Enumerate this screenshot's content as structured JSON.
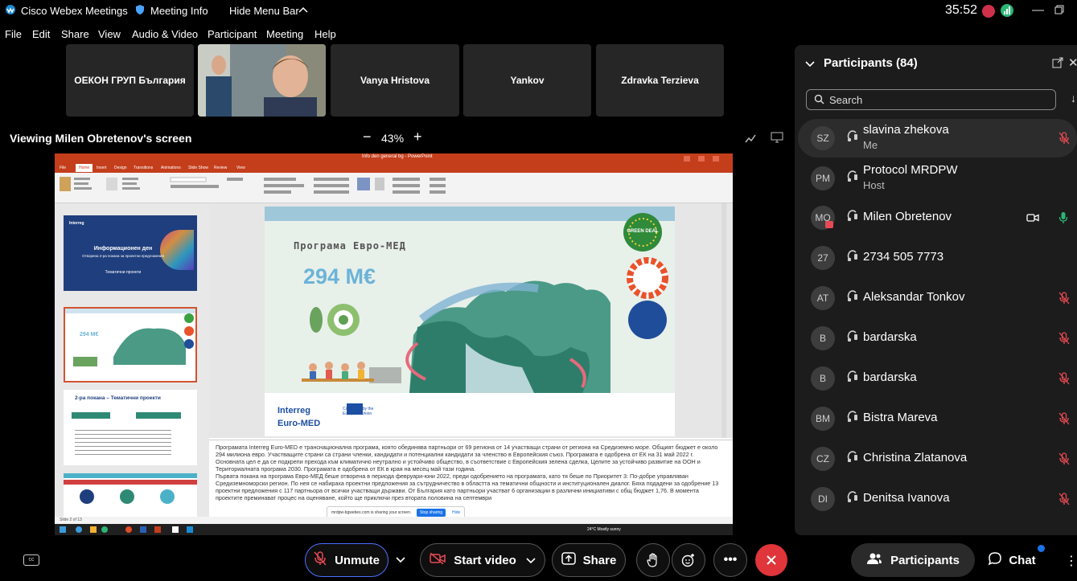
{
  "window": {
    "app_title": "Cisco Webex Meetings",
    "meeting_info": "Meeting Info",
    "hide_menu": "Hide Menu Bar",
    "timer": "35:52"
  },
  "menu": [
    "File",
    "Edit",
    "Share",
    "View",
    "Audio & Video",
    "Participant",
    "Meeting",
    "Help"
  ],
  "tiles": [
    "ОЕКОН ГРУП България",
    "",
    "Vanya Hristova",
    "Yankov",
    "Zdravka Terzieva"
  ],
  "viewing": {
    "label": "Viewing Milen Obretenov's screen",
    "zoom": "43%"
  },
  "slide": {
    "program_title": "Програма Евро-МЕД",
    "amount": "294 M€",
    "interreg": "Interreg",
    "euro_med": "Euro-MED",
    "cofunded": "Co-funded by the European Union",
    "notes_1": "Програмата Interreg Euro-MED е транснационална програма, която обединява партньори от 69 региона от 14 участващи страни от региона на Средиземно море. Общият бюджет е около 294 милиона евро. Участващите страни са страни членки, кандидати и потенциални кандидати за членство в Европейския съюз. Програмата е одобрена от ЕК на 31 май 2022 г. Основната цел е да се подкрепи прехода към климатично неутрално и устойчиво общество, в съответствие с Европейския зелена сделка, Целите за устойчиво развитие на ООН и Териториалната програма 2030. Програмата е одобрена от ЕК в края на месец май тази година.",
    "notes_2": "Първата покана на програма Евро-МЕД беше отворена в периода февруари-юни 2022, преди одобрението на програмата, като тя беше по Приоритет 3: По-добре управляван Средиземноморски регион. По нея се набираха проектни предложения за сътрудничество в областта на тематични общности и институционален диалог. Бяха подадени за одобрение 13 проектни предложения с 117 партньора от всички участващи държави. От България като партньори участват 6 организации в различни инициативи с общ бюджет 1,76. В момента проектите преминават процес на оценяване, който ще приключи през втората половина на септември",
    "sharing_text": "mrdpw-bgwebex.com is sharing your screen.",
    "stop_sharing": "Stop sharing",
    "hide": "Hide",
    "thumb1_title": "Информационен ден",
    "thumb1_sub": "Отворена 2-ра покана за проектни предложения",
    "thumb1_sub2": "Тематични проекти",
    "thumb3_title": "2-ра покана – Тематични проекти",
    "ppt_title": "Info den general bg - PowerPoint",
    "ppt_tabs": [
      "File",
      "Home",
      "Insert",
      "Design",
      "Transitions",
      "Animations",
      "Slide Show",
      "Review",
      "View"
    ],
    "status_left": "Slide 2 of 13",
    "weather": "24°C Mostly sunny"
  },
  "panel": {
    "title": "Participants (84)",
    "search_placeholder": "Search",
    "participants": [
      {
        "initials": "SZ",
        "name": "slavina zhekova",
        "role": "Me"
      },
      {
        "initials": "PM",
        "name": "Protocol MRDPW",
        "role": "Host"
      },
      {
        "initials": "MO",
        "name": "Milen Obretenov",
        "role": ""
      },
      {
        "initials": "27",
        "name": "2734 505 7773",
        "role": ""
      },
      {
        "initials": "AT",
        "name": "Aleksandar Tonkov",
        "role": ""
      },
      {
        "initials": "B",
        "name": "bardarska",
        "role": ""
      },
      {
        "initials": "B",
        "name": "bardarska",
        "role": ""
      },
      {
        "initials": "BM",
        "name": "Bistra Mareva",
        "role": ""
      },
      {
        "initials": "CZ",
        "name": "Christina Zlatanova",
        "role": ""
      },
      {
        "initials": "DI",
        "name": "Denitsa Ivanova",
        "role": ""
      }
    ]
  },
  "controls": {
    "unmute": "Unmute",
    "start_video": "Start video",
    "share": "Share",
    "participants": "Participants",
    "chat": "Chat"
  },
  "colors": {
    "end_red": "#e0353a",
    "ppt_orange": "#c43e1c",
    "mute_red": "#e84a55",
    "unmuted_green": "#2bb673"
  }
}
